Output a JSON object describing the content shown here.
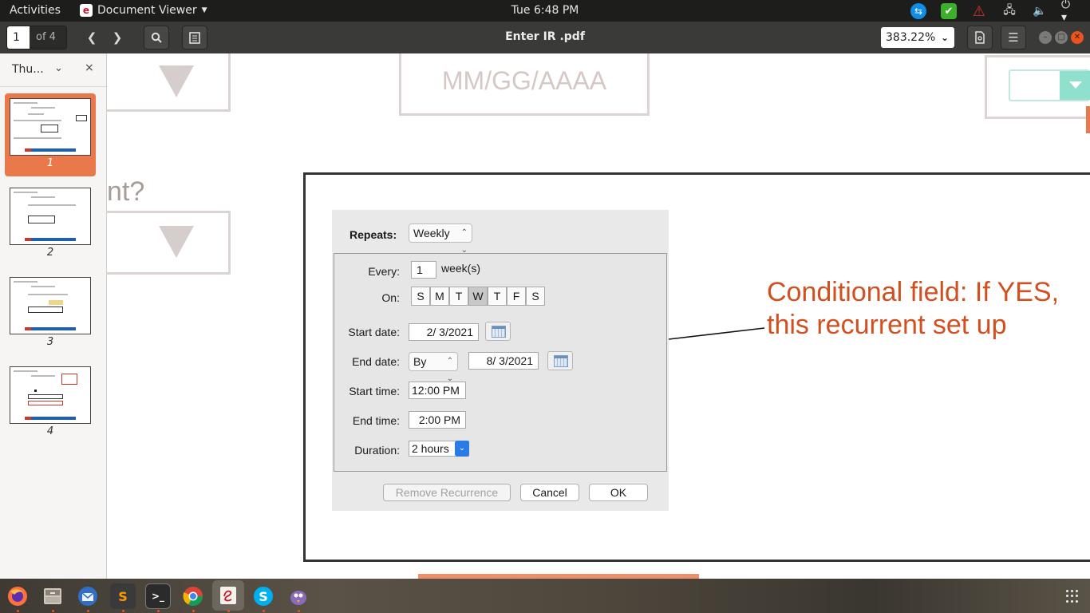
{
  "topbar": {
    "activities": "Activities",
    "app_name": "Document Viewer",
    "clock": "Tue  6:48 PM"
  },
  "header": {
    "page_current": "1",
    "page_total": "of 4",
    "title": "Enter IR .pdf",
    "zoom": "383.22%"
  },
  "sidebar": {
    "label": "Thu...",
    "thumbnails": [
      "1",
      "2",
      "3",
      "4"
    ]
  },
  "document": {
    "date_placeholder": "MM/GG/AAAA",
    "question_fragment": "nt?",
    "callout": "Conditional field: If YES, this recurrent set up",
    "dialog": {
      "repeats_label": "Repeats:",
      "repeats_value": "Weekly",
      "every_label": "Every:",
      "every_value": "1",
      "every_unit": "week(s)",
      "on_label": "On:",
      "days": [
        "S",
        "M",
        "T",
        "W",
        "T",
        "F",
        "S"
      ],
      "selected_day": "W",
      "start_date_label": "Start date:",
      "start_date_value": "2/  3/2021",
      "end_date_label": "End date:",
      "end_date_mode": "By",
      "end_date_value": "8/  3/2021",
      "start_time_label": "Start time:",
      "start_time_value": "12:00 PM",
      "end_time_label": "End time:",
      "end_time_value": "2:00 PM",
      "duration_label": "Duration:",
      "duration_value": "2 hours",
      "remove_button": "Remove Recurrence",
      "cancel_button": "Cancel",
      "ok_button": "OK"
    }
  },
  "colors": {
    "accent": "#e9784b",
    "callout": "#d2501f",
    "topbar": "#1d1d1b",
    "header": "#3a3a38"
  }
}
